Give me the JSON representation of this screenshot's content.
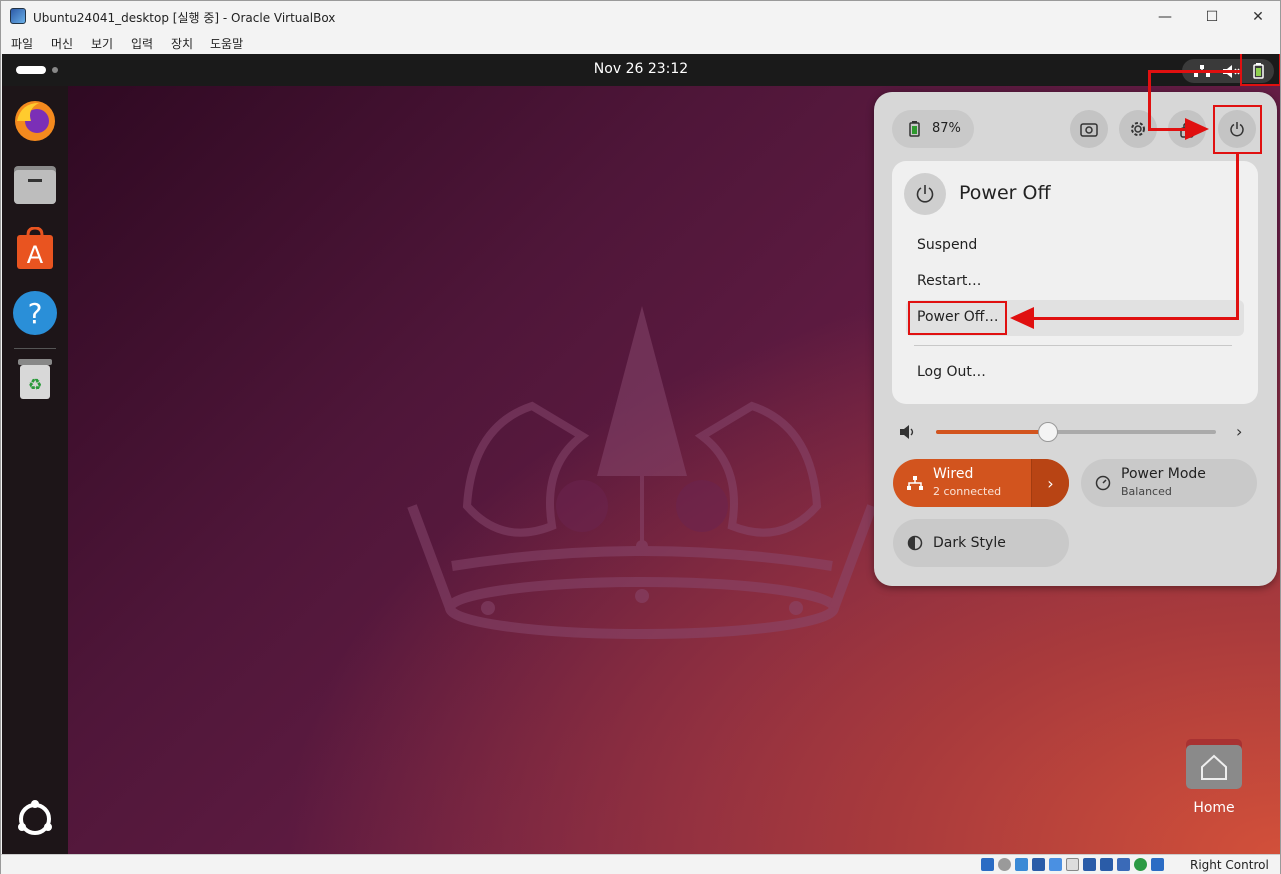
{
  "window": {
    "title": "Ubuntu24041_desktop [실행 중] - Oracle VirtualBox",
    "minimize": "—",
    "maximize": "☐",
    "close": "✕"
  },
  "menubar": [
    "파일",
    "머신",
    "보기",
    "입력",
    "장치",
    "도움말"
  ],
  "topbar": {
    "clock": "Nov 26  23:12"
  },
  "quick_settings": {
    "battery": "87%",
    "power_menu": {
      "title": "Power Off",
      "items": [
        "Suspend",
        "Restart…",
        "Power Off…",
        "Log Out…"
      ]
    },
    "volume_level": 0.4,
    "tiles": [
      {
        "title": "Wired",
        "subtitle": "2 connected",
        "active": true
      },
      {
        "title": "Power Mode",
        "subtitle": "Balanced",
        "active": false
      },
      {
        "title": "Dark Style",
        "subtitle": "",
        "active": false
      }
    ]
  },
  "desktop": {
    "home_label": "Home"
  },
  "statusbar": {
    "host_key": "Right Control"
  },
  "colors": {
    "accent": "#d2541e",
    "annotation": "#e01010"
  }
}
